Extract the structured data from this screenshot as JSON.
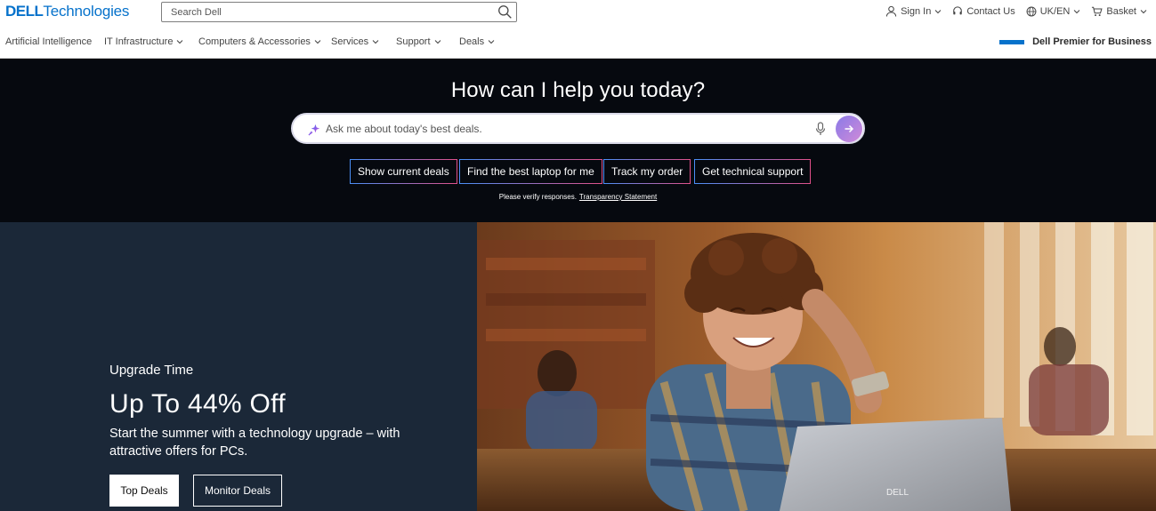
{
  "header": {
    "logo_bold": "DELL",
    "logo_rest": "Technologies",
    "search_placeholder": "Search Dell",
    "utils": {
      "sign_in": "Sign In",
      "contact": "Contact Us",
      "locale": "UK/EN",
      "basket": "Basket"
    },
    "nav": [
      "Artificial Intelligence",
      "IT Infrastructure",
      "Computers & Accessories",
      "Services",
      "Support",
      "Deals"
    ],
    "premier": "Dell Premier for Business"
  },
  "ai": {
    "title": "How can I help you today?",
    "input_placeholder": "Ask me about today's best deals.",
    "chips": [
      "Show current deals",
      "Find the best laptop for me",
      "Track my order",
      "Get technical support"
    ],
    "note": "Please verify responses.",
    "note_link": "Transparency Statement"
  },
  "hero": {
    "eyebrow": "Upgrade Time",
    "title": "Up To 44% Off",
    "description": "Start the summer with a technology upgrade – with attractive offers for PCs.",
    "btn_primary": "Top Deals",
    "btn_secondary": "Monitor Deals",
    "laptop_brand": "DELL"
  },
  "colors": {
    "brand": "#0672cb",
    "ai_band": "#06090f",
    "hero_left": "#1b2838"
  }
}
